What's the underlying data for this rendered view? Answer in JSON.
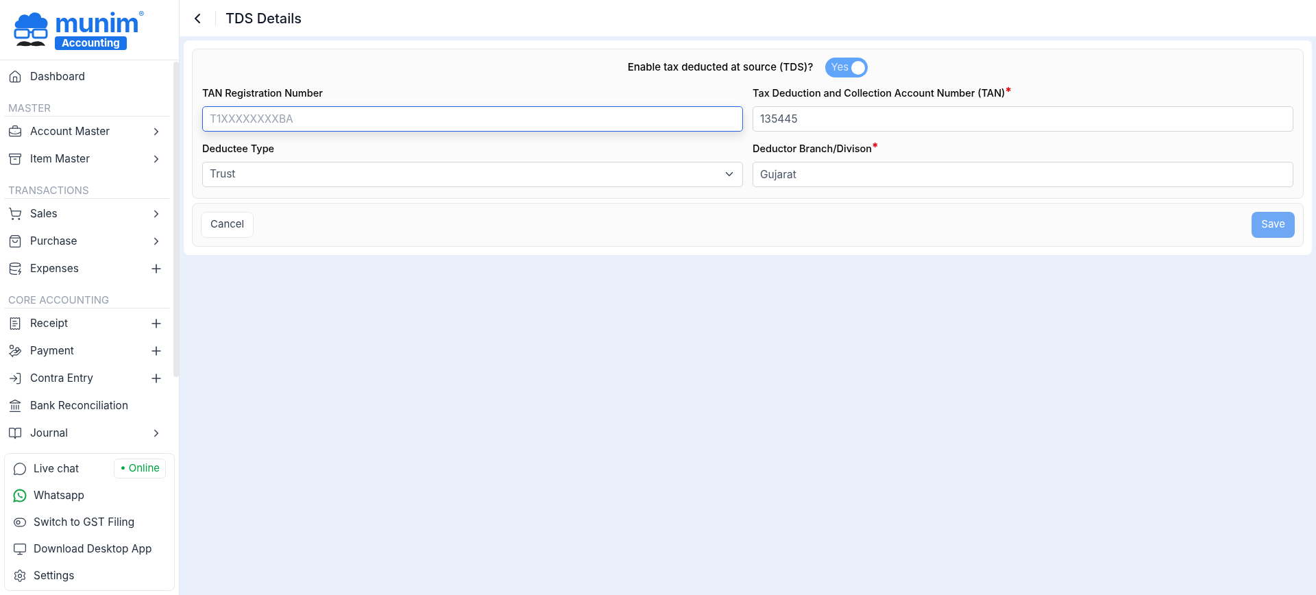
{
  "logo": {
    "name": "munim",
    "mark": "®",
    "tagline": "Accounting"
  },
  "sidebar": {
    "items": [
      {
        "kind": "link",
        "label": "Dashboard"
      },
      {
        "kind": "section",
        "label": "MASTER"
      },
      {
        "kind": "submenu",
        "label": "Account Master"
      },
      {
        "kind": "submenu",
        "label": "Item Master"
      },
      {
        "kind": "section",
        "label": "TRANSACTIONS"
      },
      {
        "kind": "submenu",
        "label": "Sales"
      },
      {
        "kind": "submenu",
        "label": "Purchase"
      },
      {
        "kind": "add",
        "label": "Expenses"
      },
      {
        "kind": "section",
        "label": "CORE ACCOUNTING"
      },
      {
        "kind": "add",
        "label": "Receipt"
      },
      {
        "kind": "add",
        "label": "Payment"
      },
      {
        "kind": "add",
        "label": "Contra Entry"
      },
      {
        "kind": "link",
        "label": "Bank Reconciliation"
      },
      {
        "kind": "submenu",
        "label": "Journal"
      }
    ],
    "footer": [
      {
        "label": "Live chat",
        "badge": "• Online"
      },
      {
        "label": "Whatsapp"
      },
      {
        "label": "Switch to GST Filing"
      },
      {
        "label": "Download Desktop App"
      },
      {
        "label": "Settings"
      }
    ]
  },
  "header": {
    "title": "TDS Details"
  },
  "form": {
    "toggle": {
      "label": "Enable tax deducted at source (TDS)?",
      "text": "Yes",
      "on": true
    },
    "fields": [
      {
        "kind": "text",
        "label": "TAN Registration Number",
        "placeholder": "T1XXXXXXXXBA",
        "focused": true
      },
      {
        "kind": "text",
        "label": "Tax Deduction and Collection Account Number (TAN)",
        "required_mark": "*",
        "value": "135445",
        "focused": false
      },
      {
        "kind": "select",
        "label": "Deductee Type",
        "value": "Trust",
        "focused": false
      },
      {
        "kind": "text",
        "label": "Deductor Branch/Divison",
        "required_mark": "*",
        "value": "Gujarat",
        "focused": false
      }
    ],
    "buttons": {
      "cancel": "Cancel",
      "save": "Save",
      "save_disabled": true
    }
  }
}
